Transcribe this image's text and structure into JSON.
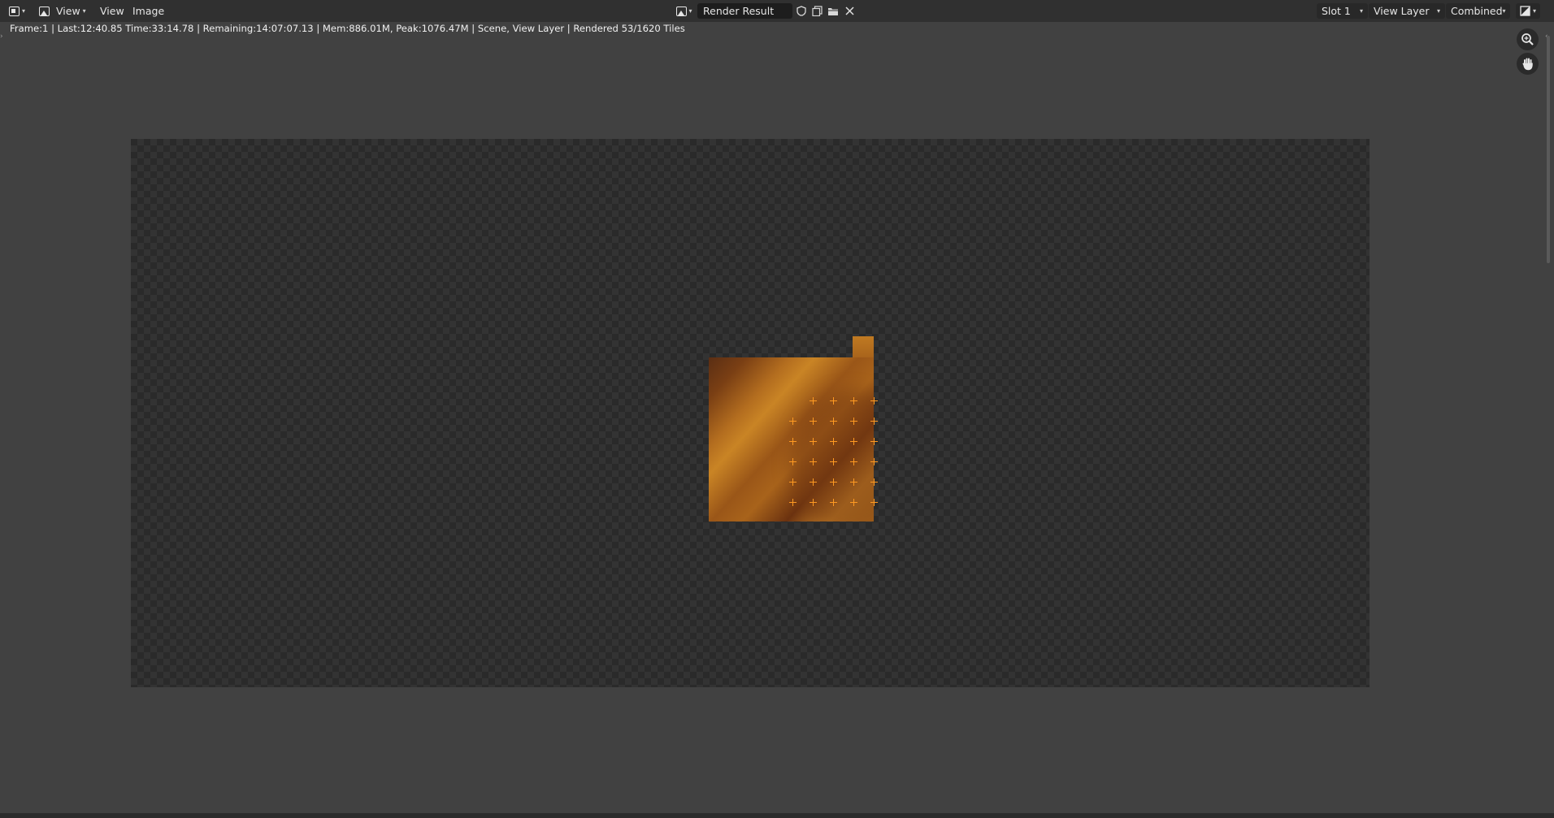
{
  "header": {
    "editor_type_icon": "image-editor-icon",
    "mode_icon": "image-mode-icon",
    "view_dropdown_label": "View",
    "menu": [
      {
        "label": "View"
      },
      {
        "label": "Image"
      }
    ],
    "image_browse_icon": "image-browse-icon",
    "image_name": "Render Result",
    "fake_user_icon": "shield-icon",
    "new_image_icon": "duplicate-icon",
    "open_image_icon": "folder-icon",
    "unlink_icon": "close-icon",
    "slot": "Slot 1",
    "view_layer": "View Layer",
    "pass": "Combined",
    "display_channels_icon": "display-channels-icon"
  },
  "status": {
    "text": "Frame:1 | Last:12:40.85 Time:33:14.78 | Remaining:14:07:07.13 | Mem:886.01M, Peak:1076.47M | Scene, View Layer | Rendered 53/1620 Tiles"
  },
  "gizmos": {
    "zoom_icon": "zoom-icon",
    "pan_icon": "hand-icon"
  },
  "canvas": {
    "content": "render-result-partial-tiles",
    "tile_color": "#b06a1e",
    "marker_color": "#ff9a22"
  }
}
